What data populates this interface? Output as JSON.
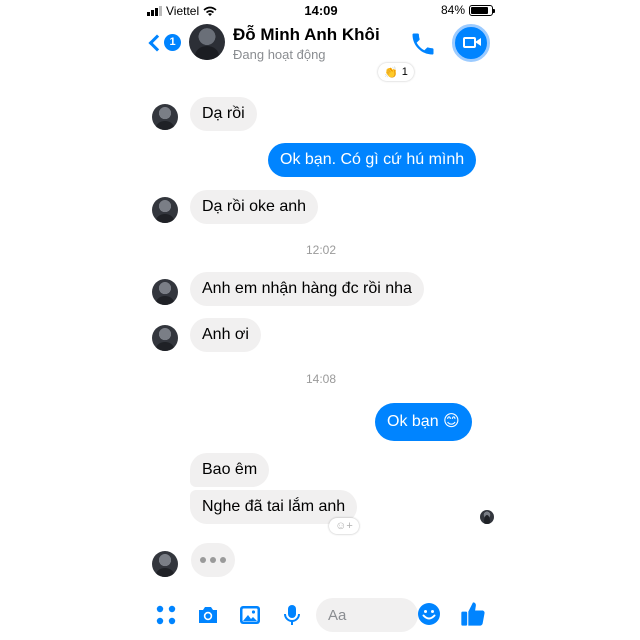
{
  "status_bar": {
    "carrier": "Viettel",
    "time": "14:09",
    "battery": "84%",
    "battery_level": 0.84
  },
  "header": {
    "back_badge": "1",
    "contact_name": "Đỗ Minh Anh Khôi",
    "contact_status": "Đang hoạt động",
    "reaction_emoji": "👏",
    "reaction_count": "1"
  },
  "messages": [
    {
      "id": "m1",
      "side": "in",
      "text": "Dạ rồi"
    },
    {
      "id": "m2",
      "side": "out",
      "text": "Ok bạn. Có gì cứ hú mình"
    },
    {
      "id": "m3",
      "side": "in",
      "text": "Dạ rồi oke anh"
    },
    {
      "id": "t1",
      "time": "12:02"
    },
    {
      "id": "m4",
      "side": "in",
      "text": "Anh em nhận hàng đc rồi nha"
    },
    {
      "id": "m5",
      "side": "in",
      "text": "Anh ơi"
    },
    {
      "id": "t2",
      "time": "14:08"
    },
    {
      "id": "m6",
      "side": "out",
      "text": "Ok bạn 😊"
    },
    {
      "id": "m7",
      "side": "in",
      "text": "Bao êm"
    },
    {
      "id": "m8",
      "side": "in",
      "text": "Nghe đã tai lắm anh"
    }
  ],
  "composer": {
    "placeholder": "Aa"
  },
  "colors": {
    "accent": "#0084ff",
    "incoming_bubble": "#f1f0f0",
    "muted_text": "#8a8d91"
  }
}
